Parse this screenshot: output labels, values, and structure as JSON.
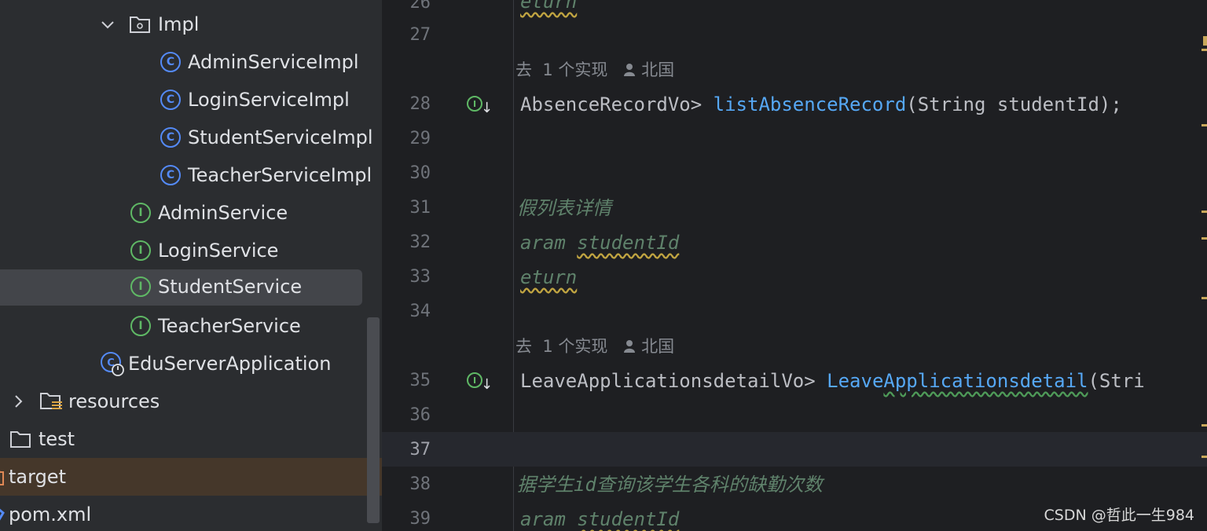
{
  "project_tree": {
    "impl_folder": "Impl",
    "impl_classes": [
      "AdminServiceImpl",
      "LoginServiceImpl",
      "StudentServiceImpl",
      "TeacherServiceImpl"
    ],
    "interfaces": [
      "AdminService",
      "LoginService",
      "StudentService",
      "TeacherService"
    ],
    "selected_item": "StudentService",
    "application_class": "EduServerApplication",
    "resources_folder": "resources",
    "test_folder": "test",
    "target_folder": "target",
    "pom_file": "pom.xml"
  },
  "editor": {
    "line_numbers": [
      "26",
      "27",
      "28",
      "29",
      "30",
      "31",
      "32",
      "33",
      "34",
      "35",
      "36",
      "37",
      "38",
      "39"
    ],
    "current_line": "37",
    "lines": {
      "l26_doc": "eturn",
      "hint1_prefix": "去",
      "hint1_impl": "1 个实现",
      "hint1_author": "北国",
      "l28_type": "AbsenceRecordVo> ",
      "l28_method": "listAbsenceRecord",
      "l28_params": "(String studentId);",
      "l31_doc": "假列表详情",
      "l32_tag": "aram ",
      "l32_param": "studentId",
      "l33_doc": "eturn",
      "hint2_prefix": "去",
      "hint2_impl": "1 个实现",
      "hint2_author": "北国",
      "l35_type": "LeaveApplicationsdetailVo> ",
      "l35_method_a": "Leave",
      "l35_method_b": "Applicationsdetail",
      "l35_params": "(Stri",
      "l38_doc": "据学生id查询该学生各科的缺勤次数",
      "l39_tag": "aram ",
      "l39_param": "studentId"
    }
  },
  "watermark": "CSDN @哲此一生984",
  "icons": {
    "chevron": "chevron-down-icon",
    "folder": "folder-icon",
    "class": "class-icon",
    "interface": "interface-icon",
    "implemented": "implemented-gutter-icon",
    "user": "user-icon"
  },
  "colors": {
    "tree_bg": "#2b2d30",
    "editor_bg": "#1e1f22",
    "class_icon": "#548af7",
    "interface_icon": "#5fb865",
    "doc_comment": "#5f826b",
    "method": "#56a8f5",
    "target_row": "#45372a"
  }
}
